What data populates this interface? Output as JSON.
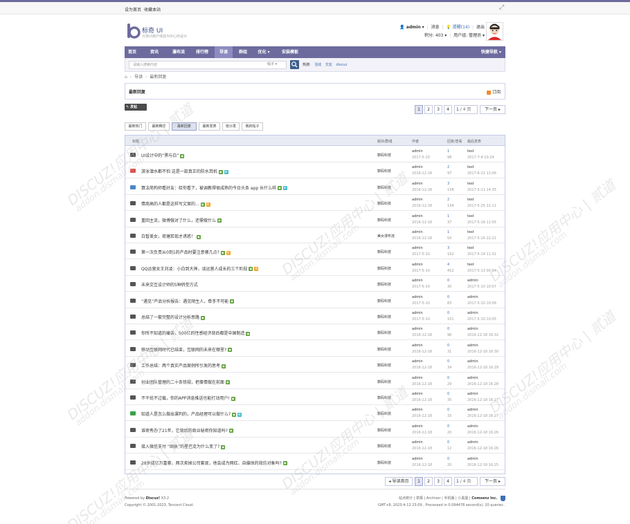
{
  "topbar": {
    "set_home": "设为首页",
    "favorite": "收藏本站"
  },
  "header": {
    "site_name": "标奇 UI",
    "slogan": "分享UI用户体验为中心的设计",
    "username": "admin",
    "messages": "消息",
    "reminders": "提醒(14)",
    "logout": "退出",
    "points": "积分: 403",
    "usergroup": "用户组: 管理员"
  },
  "nav": {
    "items": [
      "首页",
      "资讯",
      "瀑布流",
      "排行榜",
      "导读",
      "群组",
      "优化",
      "安装模板"
    ],
    "quick": "快捷导航"
  },
  "search": {
    "placeholder": "请输入搜索内容",
    "type": "帖子",
    "hot_label": "热搜:",
    "hot": [
      "活动",
      "交友",
      "discuz"
    ]
  },
  "breadcrumb": [
    "导读",
    "最新回复"
  ],
  "section": {
    "title": "最新回复",
    "subscribe": "订阅"
  },
  "post_button": "发帖",
  "pager_top": {
    "pages": [
      "1",
      "2",
      "3",
      "4"
    ],
    "goto": "1",
    "total": "/ 4 页",
    "next": "下一页"
  },
  "pager_bottom": {
    "back": "◂ 导读首页",
    "pages": [
      "1",
      "2",
      "3",
      "4"
    ],
    "goto": "1",
    "total": "/ 4 页",
    "next": "下一页"
  },
  "tabs": [
    "最新热门",
    "最新精华",
    "最新回复",
    "最新发表",
    "抢沙发",
    "我的帖子"
  ],
  "columns": {
    "title": "标题",
    "forum": "版块/群组",
    "author": "作者",
    "stats": "回复/查看",
    "last": "最后发表"
  },
  "threads": [
    {
      "title": "UI设计中的“黑与白”",
      "tags": [
        "img"
      ],
      "forum": "数码科技",
      "author": "admin",
      "date": "2017-5-10",
      "replies": "1",
      "views": "98",
      "last_user": "test",
      "last_date": "2017-7-4 10:24",
      "icon": "mail"
    },
    {
      "title": "游泳潜水都不怕 这是一款真正的防水耳机",
      "tags": [
        "img",
        "new"
      ],
      "forum": "数码科技",
      "author": "admin",
      "date": "2016-12-18",
      "replies": "2",
      "views": "97",
      "last_user": "test",
      "last_date": "2017-6-22 13:06",
      "icon": "down"
    },
    {
      "title": "算法简构师看好友：给你看下，被调教得很成熟的今日头条 app 长什么样",
      "tags": [
        "img",
        "new"
      ],
      "forum": "数码科技",
      "author": "admin",
      "date": "2016-12-18",
      "replies": "3",
      "views": "158",
      "last_user": "test",
      "last_date": "2017-5-11 14:35",
      "icon": "up"
    },
    {
      "title": "情商高的人都是这样写文案的...",
      "tags": [
        "img",
        "hot"
      ],
      "forum": "数码科技",
      "author": "admin",
      "date": "2016-12-18",
      "replies": "2",
      "views": "134",
      "last_user": "test",
      "last_date": "2017-5-25 22:11",
      "icon": "mail"
    },
    {
      "title": "重回主流，微博做对了什么，还需做什么",
      "tags": [
        "img"
      ],
      "forum": "数码科技",
      "author": "admin",
      "date": "2016-12-18",
      "replies": "1",
      "views": "37",
      "last_user": "test",
      "last_date": "2017-5-18 11:05",
      "icon": "mail"
    },
    {
      "title": "白皙美女，荷塘若现才诱惑！",
      "tags": [
        "img"
      ],
      "forum": "美女漫布流",
      "author": "admin",
      "date": "2016-12-18",
      "replies": "1",
      "views": "50",
      "last_user": "test",
      "last_date": "2017-5-16 22:21",
      "icon": "mail"
    },
    {
      "title": "第一次负责从0到1的产品时要注意哪几点?",
      "tags": [
        "img",
        "hot"
      ],
      "forum": "数码科技",
      "author": "admin",
      "date": "2017-5-10",
      "replies": "3",
      "views": "162",
      "last_user": "test",
      "last_date": "2017-5-14 11:31",
      "icon": "mail"
    },
    {
      "title": "QQ运营女王刘凌：小白到大神，谈运营人成长的三个阶段",
      "tags": [
        "img",
        "hot"
      ],
      "forum": "数码科技",
      "author": "admin",
      "date": "2017-5-10",
      "replies": "4",
      "views": "452",
      "last_user": "test",
      "last_date": "2017-5-13 00:54",
      "icon": "mail"
    },
    {
      "title": "未来交互设计师的5种转型方式",
      "tags": [],
      "forum": "数码科技",
      "author": "admin",
      "date": "2017-5-10",
      "replies": "0",
      "views": "30",
      "last_user": "admin",
      "last_date": "2017-5-10 10:07",
      "icon": "mail"
    },
    {
      "title": "“遇见”产品分析报告：遇见陌生人，牵手不可能",
      "tags": [
        "img"
      ],
      "forum": "数码科技",
      "author": "admin",
      "date": "2017-5-10",
      "replies": "0",
      "views": "83",
      "last_user": "admin",
      "last_date": "2017-5-10 10:06",
      "icon": "mail"
    },
    {
      "title": "总结了一套完整的设计分析思路",
      "tags": [
        "img"
      ],
      "forum": "数码科技",
      "author": "admin",
      "date": "2017-5-10",
      "replies": "0",
      "views": "101",
      "last_user": "admin",
      "last_date": "2017-5-10 10:05",
      "icon": "mail"
    },
    {
      "title": "你所不知道的痛苦，500亿的性感经济背后都是中国制造",
      "tags": [
        "img"
      ],
      "forum": "数码科技",
      "author": "admin",
      "date": "2016-12-18",
      "replies": "0",
      "views": "96",
      "last_user": "admin",
      "last_date": "2016-12-18 16:32",
      "icon": "mail"
    },
    {
      "title": "移动互联网时代已结束，互联网的未来在哪里?",
      "tags": [
        "img"
      ],
      "forum": "数码科技",
      "author": "admin",
      "date": "2016-12-18",
      "replies": "0",
      "views": "31",
      "last_user": "admin",
      "last_date": "2016-12-18 16:30",
      "icon": "mail"
    },
    {
      "title": "工作总结：两个真实产品案例所引发的思考",
      "tags": [
        "img"
      ],
      "forum": "数码科技",
      "author": "admin",
      "date": "2016-12-18",
      "replies": "0",
      "views": "34",
      "last_user": "admin",
      "last_date": "2016-12-18 16:29",
      "icon": "mail"
    },
    {
      "title": "创业团队管理的二十条铁规，把事情做在前面",
      "tags": [
        "img"
      ],
      "forum": "数码科技",
      "author": "admin",
      "date": "2016-12-18",
      "replies": "0",
      "views": "29",
      "last_user": "admin",
      "last_date": "2016-12-18 16:28",
      "icon": "mail"
    },
    {
      "title": "不干扰不过载，你的APP消息推送也能打动用户!",
      "tags": [
        "img"
      ],
      "forum": "数码科技",
      "author": "admin",
      "date": "2016-12-18",
      "replies": "0",
      "views": "35",
      "last_user": "admin",
      "last_date": "2016-12-18 16:27",
      "icon": "mail"
    },
    {
      "title": "知道人是怎么做出课判的，产品经理可以做什么?",
      "tags": [
        "img",
        "new"
      ],
      "forum": "数码科技",
      "author": "admin",
      "date": "2016-12-18",
      "replies": "0",
      "views": "33",
      "last_user": "admin",
      "last_date": "2016-12-18 16:27",
      "icon": "green"
    },
    {
      "title": "谁密秀办了21年，它背后的商业秘密你知道吗?",
      "tags": [
        "img"
      ],
      "forum": "数码科技",
      "author": "admin",
      "date": "2016-12-18",
      "replies": "0",
      "views": "20",
      "last_user": "admin",
      "last_date": "2016-12-18 16:26",
      "icon": "mail"
    },
    {
      "title": "接入微信支付 “固执”的星巴克为什么变了?",
      "tags": [
        "img"
      ],
      "forum": "数码科技",
      "author": "admin",
      "date": "2016-12-18",
      "replies": "0",
      "views": "12",
      "last_user": "admin",
      "last_date": "2016-12-18 16:26",
      "icon": "mail"
    },
    {
      "title": "28岁成亿万富豪，两次卖掉公司套现，他会成为网红、自媒体的效仿对象吗?",
      "tags": [
        "img"
      ],
      "forum": "数码科技",
      "author": "admin",
      "date": "2016-12-18",
      "replies": "0",
      "views": "20",
      "last_user": "admin",
      "last_date": "2016-12-18 16:25",
      "icon": "mail"
    }
  ],
  "footer": {
    "powered": "Powered by",
    "product": "Discuz!",
    "version": "X3.2",
    "copyright": "Copyright © 2001-2023, Tencent Cloud.",
    "links": [
      "站点统计",
      "举报",
      "Archiver",
      "手机版",
      "小黑屋"
    ],
    "company": "Comsenz Inc.",
    "stats": "GMT+8, 2023-4-12 23:09 , Processed in 0.094478 second(s), 20 queries ."
  },
  "watermark": {
    "cn": "DISCUZ!应用中心 | 贰道",
    "url": "addon.dismall.com"
  },
  "tag_labels": {
    "img": "▣",
    "hot": "热",
    "new": "新"
  },
  "colors": {
    "nav": "#6d6b9e",
    "nav_active": "#8d8bc0",
    "link": "#3e6fb2",
    "border": "#c5cbe6"
  }
}
